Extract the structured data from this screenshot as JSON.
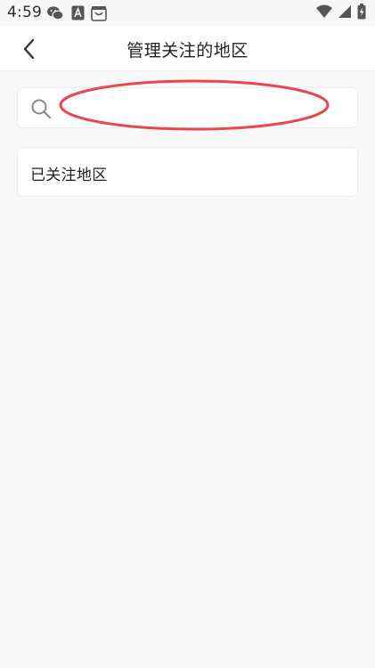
{
  "status_bar": {
    "time": "4:59",
    "left_icons": [
      "wechat-icon",
      "a-badge-icon",
      "shopping-bag-icon"
    ],
    "right_icons": [
      "wifi-icon",
      "cellular-signal-icon",
      "battery-charging-icon"
    ]
  },
  "header": {
    "title": "管理关注的地区",
    "back_icon": "chevron-left-icon"
  },
  "search": {
    "value": "",
    "placeholder": "",
    "icon": "search-icon"
  },
  "annotation": {
    "color": "#e9474e"
  },
  "followed": {
    "label": "已关注地区"
  },
  "colors": {
    "background": "#f8f8f8",
    "card": "#ffffff",
    "border": "#ececec",
    "highlight": "#e9474e"
  }
}
